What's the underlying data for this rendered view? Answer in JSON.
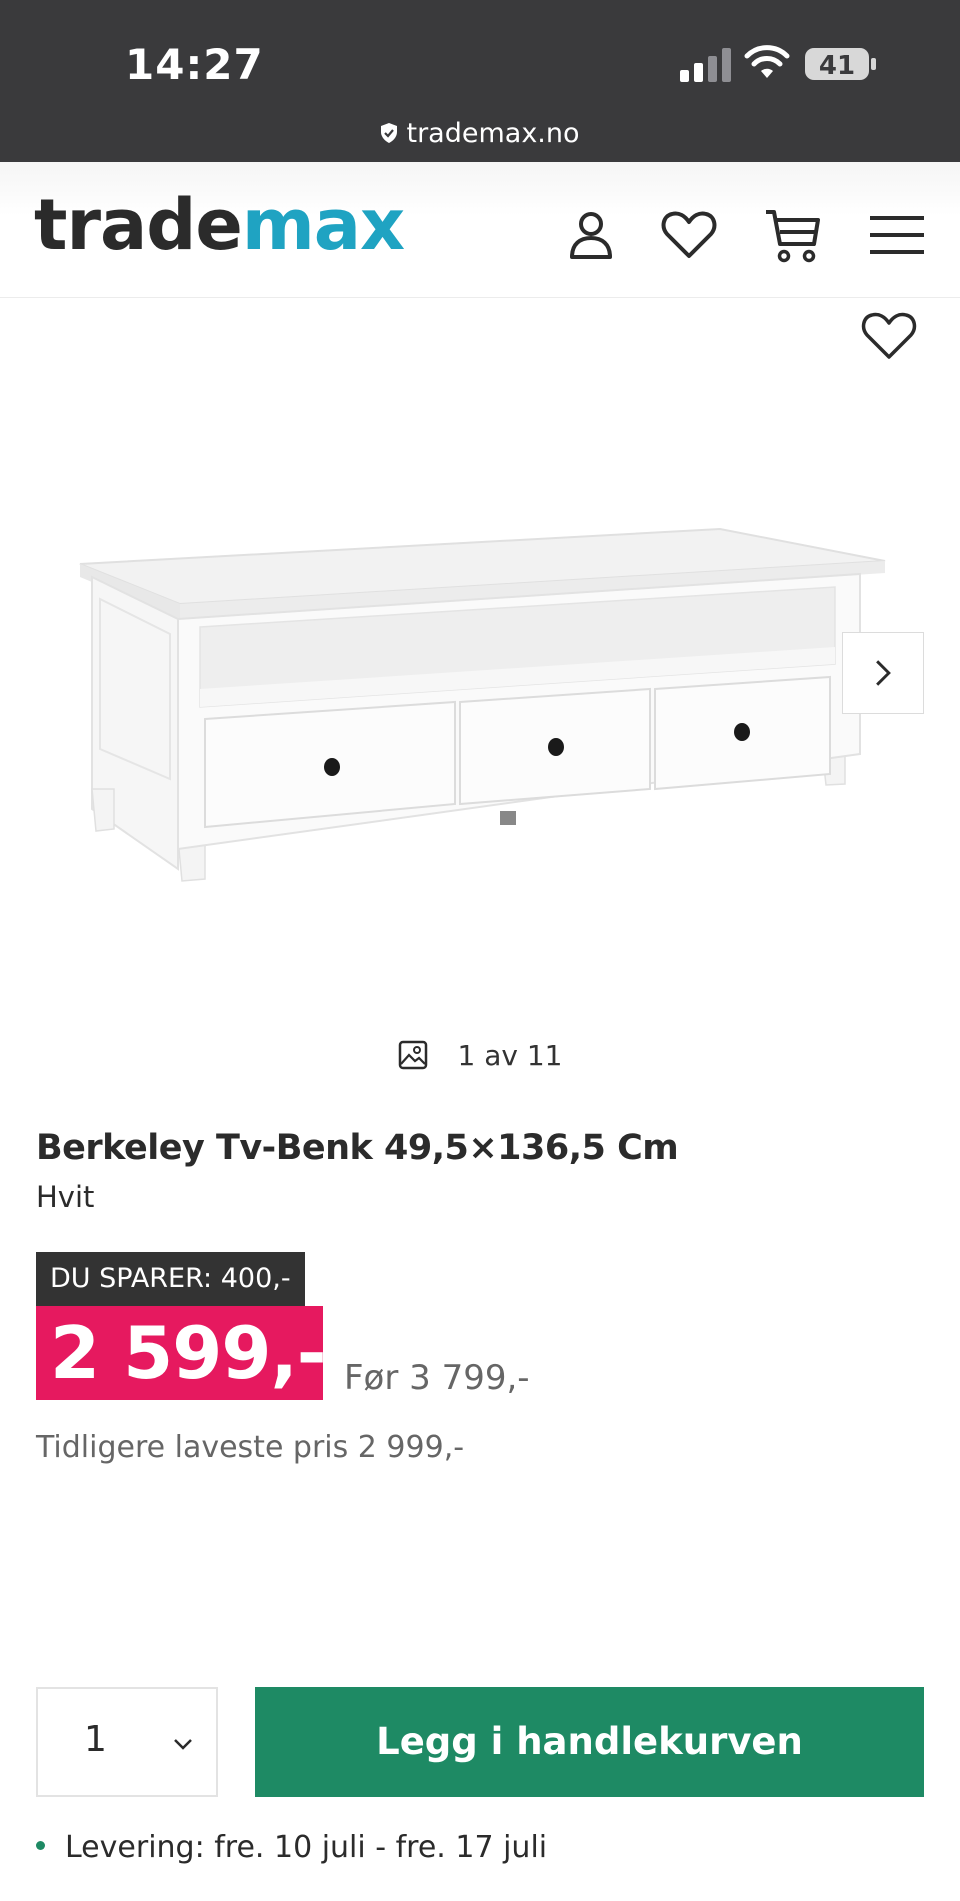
{
  "status_bar": {
    "time": "14:27",
    "battery": "41",
    "url": "trademax.no"
  },
  "header": {
    "logo_part1": "trade",
    "logo_part2": "max",
    "logo_colors": {
      "dark": "#2b2b2b",
      "accent": "#1fa3c2"
    },
    "icons": [
      "user-icon",
      "heart-icon",
      "cart-icon",
      "menu-icon"
    ]
  },
  "gallery": {
    "counter": "1 av 11",
    "icons": [
      "favorite-icon",
      "chevron-right-icon",
      "image-icon"
    ]
  },
  "product": {
    "title": "Berkeley Tv-Benk 49,5×136,5 Cm",
    "variant": "Hvit",
    "save_label": "DU SPARER: 400,-",
    "price": "2 599,-",
    "old_price": "Før 3 799,-",
    "lowest_price": "Tidligere laveste pris 2 999,-"
  },
  "buy": {
    "quantity": "1",
    "add_to_cart": "Legg i handlekurven",
    "delivery": "Levering: fre. 10 juli - fre. 17 juli"
  },
  "colors": {
    "price_bg": "#e6195f",
    "cta_bg": "#1e8a64",
    "badge_bg": "#333333"
  }
}
